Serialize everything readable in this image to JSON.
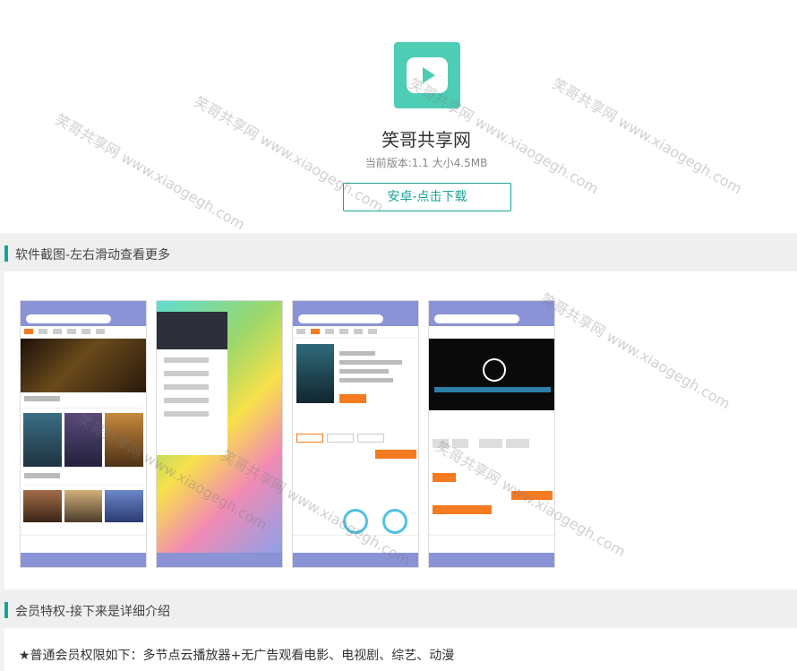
{
  "app": {
    "name": "笑哥共享网",
    "meta": "当前版本:1.1 大小4.5MB",
    "download_label": "安卓-点击下载",
    "icon": "play-icon",
    "accent": "#1aa394",
    "icon_bg": "#4ecdb5"
  },
  "screenshots_section": {
    "title": "软件截图-左右滑动查看更多"
  },
  "vip_section": {
    "title": "会员特权-接下来是详细介绍",
    "line": "★普通会员权限如下：多节点云播放器+无广告观看电影、电视剧、综艺、动漫"
  },
  "watermark": {
    "text": "笑哥共享网 www.xiaogegh.com"
  }
}
